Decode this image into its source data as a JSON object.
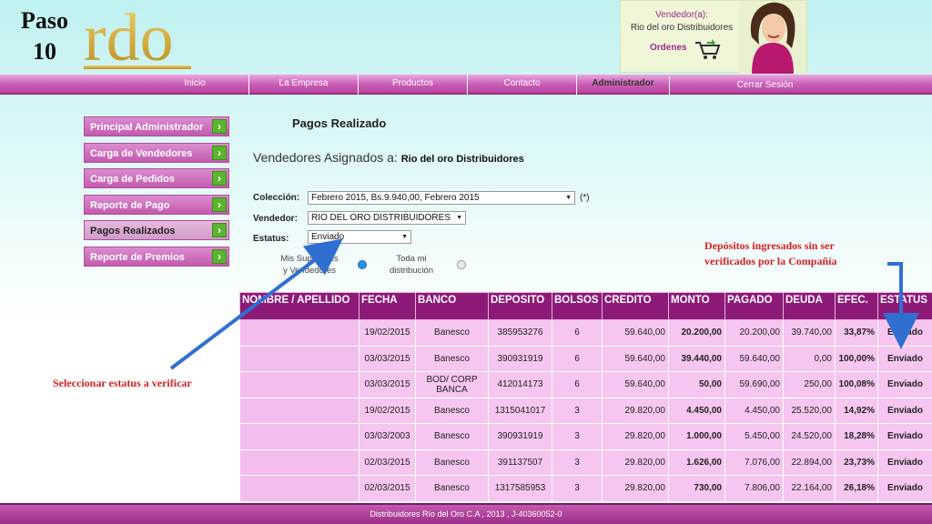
{
  "slide": {
    "step_word": "Paso",
    "step_number": "10"
  },
  "logo": {
    "text": "rdo"
  },
  "vendor_box": {
    "title": "Vendedor(a):",
    "name": "Rio del oro Distribuidores",
    "orders_label": "Ordenes"
  },
  "nav": {
    "items": [
      "Inicio",
      "La Empresa",
      "Productos",
      "Contacto",
      "Administrador"
    ],
    "logout": "Cerrar Sesión"
  },
  "sidebar": {
    "items": [
      {
        "label": "Principal Administrador"
      },
      {
        "label": "Carga de Vendedores"
      },
      {
        "label": "Carga de Pedidos"
      },
      {
        "label": "Reporte de Pago"
      },
      {
        "label": "Pagos Realizados"
      },
      {
        "label": "Reporte de Premios"
      }
    ]
  },
  "main": {
    "title": "Pagos Realizado",
    "assigned_prefix": "Vendedores Asignados a:",
    "assigned_name": "Rio del oro Distribuidores"
  },
  "form": {
    "coleccion_label": "Colección:",
    "coleccion_value": "Febrero 2015, Bs.9.940,00, Febrero 2015",
    "required_mark": "(*)",
    "vendedor_label": "Vendedor:",
    "vendedor_value": "RIO DEL ORO DISTRIBUIDORES",
    "estatus_label": "Estatus:",
    "estatus_value": "Enviado",
    "radio1_line1": "Mis Superiores",
    "radio1_line2": "y Vendedores",
    "radio2_line1": "Toda mi",
    "radio2_line2": "distribución"
  },
  "annotations": {
    "left": "Seleccionar estatus a verificar",
    "right_line1": "Depósitos ingresados sin ser",
    "right_line2": "verificados por la Compañía"
  },
  "table": {
    "headers": [
      "NOMBRE / APELLIDO",
      "FECHA",
      "BANCO",
      "DEPOSITO",
      "BOLSOS",
      "CREDITO",
      "MONTO",
      "PAGADO",
      "DEUDA",
      "EFEC.",
      "ESTATUS"
    ],
    "rows": [
      [
        "",
        "19/02/2015",
        "Banesco",
        "385953276",
        "6",
        "59.640,00",
        "20.200,00",
        "20.200,00",
        "39.740,00",
        "33,87%",
        "Enviado"
      ],
      [
        "",
        "03/03/2015",
        "Banesco",
        "390931919",
        "6",
        "59.640,00",
        "39.440,00",
        "59.640,00",
        "0,00",
        "100,00%",
        "Enviado"
      ],
      [
        "",
        "03/03/2015",
        "BOD/ CORP BANCA",
        "412014173",
        "6",
        "59.640,00",
        "50,00",
        "59.690,00",
        "250,00",
        "100,08%",
        "Enviado"
      ],
      [
        "",
        "19/02/2015",
        "Banesco",
        "1315041017",
        "3",
        "29.820,00",
        "4.450,00",
        "4.450,00",
        "25.520,00",
        "14,92%",
        "Enviado"
      ],
      [
        "",
        "03/03/2003",
        "Banesco",
        "390931919",
        "3",
        "29.820,00",
        "1.000,00",
        "5.450,00",
        "24.520,00",
        "18,28%",
        "Enviado"
      ],
      [
        "",
        "02/03/2015",
        "Banesco",
        "391137507",
        "3",
        "29.820,00",
        "1.626,00",
        "7.076,00",
        "22.894,00",
        "23,73%",
        "Enviado"
      ],
      [
        "",
        "02/03/2015",
        "Banesco",
        "1317585953",
        "3",
        "29.820,00",
        "730,00",
        "7.806,00",
        "22.164,00",
        "26,18%",
        "Enviado"
      ]
    ]
  },
  "footer": {
    "text": "Distribuidores Río del Oro C.A , 2013 , J-40360052-0"
  },
  "colors": {
    "accent": "#c25aad",
    "header": "#8e1a78",
    "row": "#f6c6f0",
    "annotation": "#d62020",
    "arrow": "#2f6fd0"
  }
}
